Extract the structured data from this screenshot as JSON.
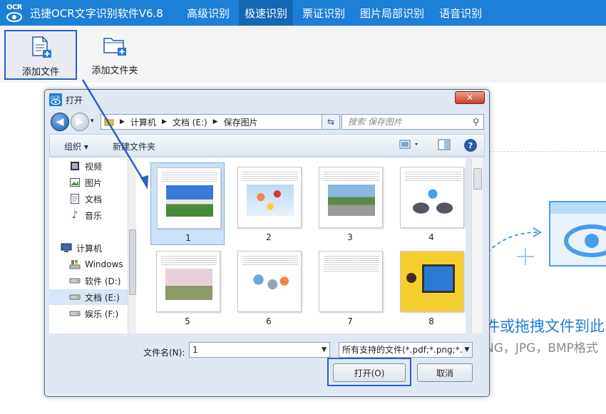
{
  "app": {
    "logo_text": "OCR",
    "title": "迅捷OCR文字识别软件V6.8",
    "tabs": [
      "高级识别",
      "极速识别",
      "票证识别",
      "图片局部识别",
      "语音识别"
    ],
    "active_tab": 1
  },
  "toolbar": {
    "add_file": "添加文件",
    "add_folder": "添加文件夹"
  },
  "drop_area": {
    "main_text": "件或拖拽文件到此",
    "sub_text": "NG，JPG，BMP格式"
  },
  "dialog": {
    "title": "打开",
    "close": "✕",
    "path": [
      "计算机",
      "文档 (E:)",
      "保存图片"
    ],
    "search_placeholder": "搜索 保存图片",
    "organize": "组织 ▾",
    "new_folder": "新建文件夹",
    "help": "?",
    "nav_items": [
      {
        "label": "视频",
        "icon": "video-icon"
      },
      {
        "label": "图片",
        "icon": "picture-icon"
      },
      {
        "label": "文档",
        "icon": "document-icon"
      },
      {
        "label": "音乐",
        "icon": "music-icon"
      },
      {
        "label": "计算机",
        "icon": "computer-icon"
      },
      {
        "label": "Windows",
        "icon": "windows-drive-icon"
      },
      {
        "label": "软件 (D:)",
        "icon": "drive-icon"
      },
      {
        "label": "文档 (E:)",
        "icon": "drive-icon"
      },
      {
        "label": "娱乐 (F:)",
        "icon": "drive-icon"
      }
    ],
    "files": [
      "1",
      "2",
      "3",
      "4",
      "5",
      "6",
      "7",
      "8"
    ],
    "selected_file": "1",
    "filename_label": "文件名(N):",
    "filename_value": "1",
    "filetype_value": "所有支持的文件(*.pdf;*.png;*.j",
    "open_button": "打开(O)",
    "cancel_button": "取消"
  },
  "colors": {
    "brand": "#1d7fd6",
    "active_tab": "#1467b3",
    "highlight": "#2b5fc5"
  }
}
